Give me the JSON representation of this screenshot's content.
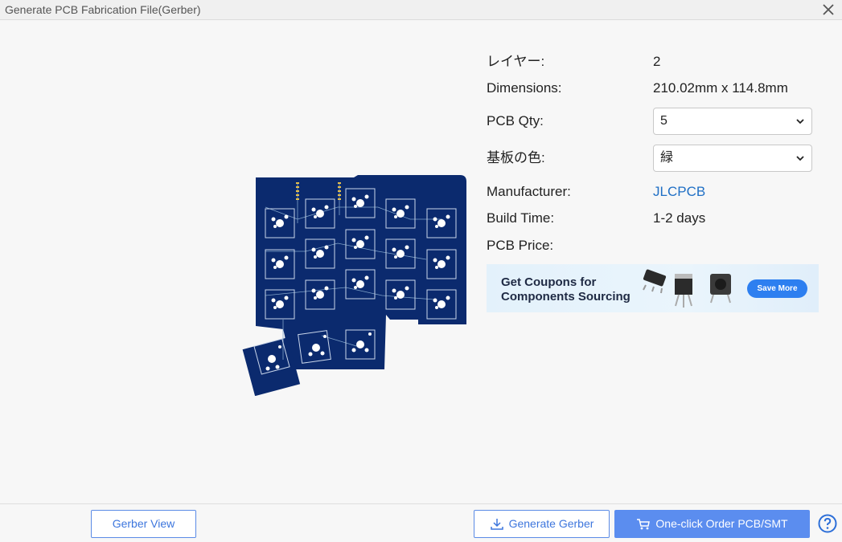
{
  "window": {
    "title": "Generate PCB Fabrication File(Gerber)"
  },
  "info": {
    "layers": {
      "label": "レイヤー:",
      "value": "2"
    },
    "dimensions": {
      "label": "Dimensions:",
      "value": "210.02mm x 114.8mm"
    },
    "qty": {
      "label": "PCB Qty:",
      "value": "5"
    },
    "color": {
      "label": "基板の色:",
      "value": "緑"
    },
    "manufacturer": {
      "label": "Manufacturer:",
      "value": "JLCPCB"
    },
    "build_time": {
      "label": "Build Time:",
      "value": "1-2 days"
    },
    "price": {
      "label": "PCB Price:",
      "value": ""
    }
  },
  "banner": {
    "line1": "Get Coupons for",
    "line2": "Components Sourcing",
    "button": "Save More"
  },
  "footer": {
    "gerber_view": "Gerber View",
    "generate_gerber": "Generate Gerber",
    "order": "One-click Order PCB/SMT"
  },
  "colors": {
    "pcb": "#0b2a6e",
    "accent": "#5b8def",
    "link": "#1f6fc5"
  }
}
